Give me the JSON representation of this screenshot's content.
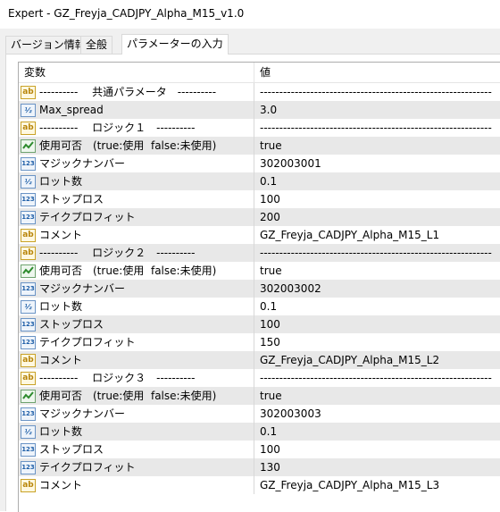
{
  "window": {
    "title": "Expert - GZ_Freyja_CADJPY_Alpha_M15_v1.0"
  },
  "tabs": [
    {
      "label": "バージョン情報",
      "active": false
    },
    {
      "label": "全般",
      "active": false
    },
    {
      "label": "パラメーターの入力",
      "active": true
    }
  ],
  "grid": {
    "headers": {
      "variable": "変数",
      "value": "値"
    },
    "rows": [
      {
        "type": "string",
        "icon": "ab-icon",
        "name": "----------　 共通パラメータ　----------",
        "value": "------------------------------------------------------------"
      },
      {
        "type": "double",
        "icon": "double-icon",
        "name": "Max_spread",
        "value": "3.0"
      },
      {
        "type": "string",
        "icon": "ab-icon",
        "name": "----------　 ロジック１　----------",
        "value": "------------------------------------------------------------"
      },
      {
        "type": "bool",
        "icon": "bool-icon",
        "name": "使用可否　(true:使用  false:未使用)",
        "value": "true"
      },
      {
        "type": "int",
        "icon": "int-icon",
        "name": "マジックナンバー",
        "value": "302003001"
      },
      {
        "type": "double",
        "icon": "double-icon",
        "name": "ロット数",
        "value": "0.1"
      },
      {
        "type": "int",
        "icon": "int-icon",
        "name": "ストップロス",
        "value": "100"
      },
      {
        "type": "int",
        "icon": "int-icon",
        "name": "テイクプロフィット",
        "value": "200"
      },
      {
        "type": "string",
        "icon": "ab-icon",
        "name": "コメント",
        "value": "GZ_Freyja_CADJPY_Alpha_M15_L1"
      },
      {
        "type": "string",
        "icon": "ab-icon",
        "name": "----------　 ロジック２　----------",
        "value": "------------------------------------------------------------"
      },
      {
        "type": "bool",
        "icon": "bool-icon",
        "name": "使用可否　(true:使用  false:未使用)",
        "value": "true"
      },
      {
        "type": "int",
        "icon": "int-icon",
        "name": "マジックナンバー",
        "value": "302003002"
      },
      {
        "type": "double",
        "icon": "double-icon",
        "name": "ロット数",
        "value": "0.1"
      },
      {
        "type": "int",
        "icon": "int-icon",
        "name": "ストップロス",
        "value": "100"
      },
      {
        "type": "int",
        "icon": "int-icon",
        "name": "テイクプロフィット",
        "value": "150"
      },
      {
        "type": "string",
        "icon": "ab-icon",
        "name": "コメント",
        "value": "GZ_Freyja_CADJPY_Alpha_M15_L2"
      },
      {
        "type": "string",
        "icon": "ab-icon",
        "name": "----------　 ロジック３　----------",
        "value": "------------------------------------------------------------"
      },
      {
        "type": "bool",
        "icon": "bool-icon",
        "name": "使用可否　(true:使用  false:未使用)",
        "value": "true"
      },
      {
        "type": "int",
        "icon": "int-icon",
        "name": "マジックナンバー",
        "value": "302003003"
      },
      {
        "type": "double",
        "icon": "double-icon",
        "name": "ロット数",
        "value": "0.1"
      },
      {
        "type": "int",
        "icon": "int-icon",
        "name": "ストップロス",
        "value": "100"
      },
      {
        "type": "int",
        "icon": "int-icon",
        "name": "テイクプロフィット",
        "value": "130"
      },
      {
        "type": "string",
        "icon": "ab-icon",
        "name": "コメント",
        "value": "GZ_Freyja_CADJPY_Alpha_M15_L3"
      }
    ]
  }
}
